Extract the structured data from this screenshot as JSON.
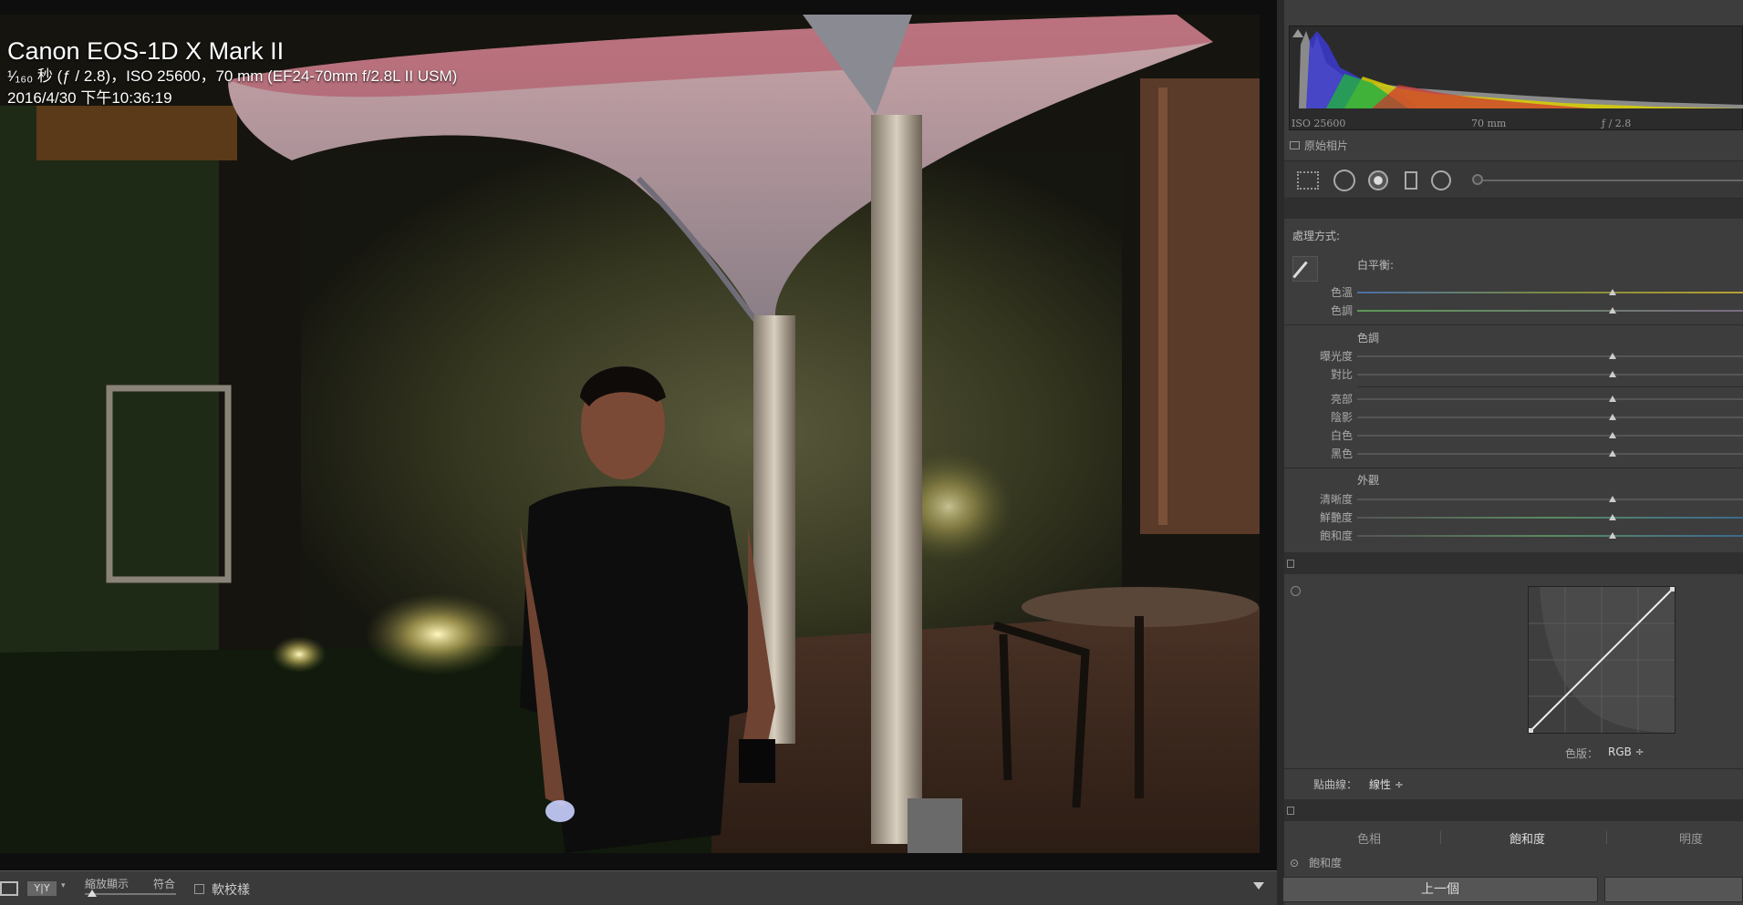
{
  "photo": {
    "camera_model": "Canon EOS-1D X Mark II",
    "exposure_line": "¹⁄₁₆₀ 秒 (ƒ / 2.8)，ISO 25600，70 mm (EF24-70mm f/2.8L II USM)",
    "date_line": "2016/4/30 下午10:36:19"
  },
  "toolbar": {
    "compare_icon_text": "Y|Y",
    "zoom_label": "縮放顯示",
    "zoom_value": "符合",
    "softproof_label": "軟校樣",
    "softproof_checked": false
  },
  "histogram": {
    "iso": "ISO 25600",
    "focal": "70 mm",
    "aperture": "ƒ / 2.8",
    "original_label": "原始相片"
  },
  "basic": {
    "treatment_label": "處理方式:",
    "wb_label": "白平衡:",
    "tone_title": "色調",
    "presence_title": "外觀",
    "sliders": {
      "temp": "色溫",
      "tint": "色調",
      "exposure": "曝光度",
      "contrast": "對比",
      "highlights": "亮部",
      "shadows": "陰影",
      "whites": "白色",
      "blacks": "黑色",
      "clarity": "清晰度",
      "vibrance": "鮮艷度",
      "saturation": "飽和度"
    }
  },
  "curve": {
    "channel_label": "色版：",
    "channel_value": "RGB ÷",
    "point_curve_label": "點曲線：",
    "point_curve_value": "線性 ÷"
  },
  "hsl": {
    "tabs": [
      "色相",
      "飽和度",
      "明度"
    ],
    "active_tab": "飽和度",
    "sub_label": "飽和度"
  },
  "nav": {
    "prev_label": "上一個"
  },
  "colors": {
    "panel_bg": "#3d3d3d",
    "viewer_bg": "#0e0e0e",
    "temp_track": "#4b6fa8",
    "tint_track": "#5a9a55"
  }
}
